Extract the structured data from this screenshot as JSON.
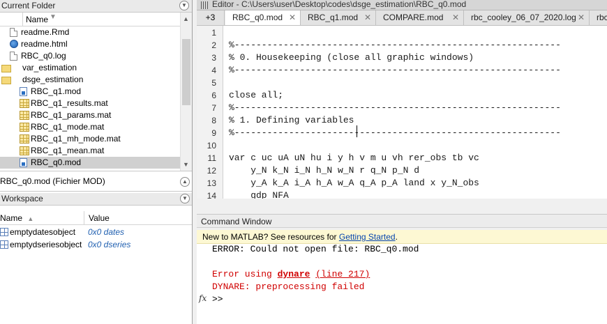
{
  "current_folder": {
    "title": "Current Folder",
    "name_header": "Name",
    "sort_indicator": "▼",
    "files": [
      {
        "name": "readme.Rmd",
        "icon": "document-icon",
        "indent": 0
      },
      {
        "name": "readme.html",
        "icon": "html-file-icon",
        "indent": 0
      },
      {
        "name": "RBC_q0.log",
        "icon": "document-icon",
        "indent": 0
      },
      {
        "name": "var_estimation",
        "icon": "folder-icon",
        "indent": 0
      },
      {
        "name": "dsge_estimation",
        "icon": "folder-icon",
        "indent": 0
      },
      {
        "name": "RBC_q1.mod",
        "icon": "mod-file-icon",
        "indent": 1
      },
      {
        "name": "RBC_q1_results.mat",
        "icon": "mat-file-icon",
        "indent": 1
      },
      {
        "name": "RBC_q1_params.mat",
        "icon": "mat-file-icon",
        "indent": 1
      },
      {
        "name": "RBC_q1_mode.mat",
        "icon": "mat-file-icon",
        "indent": 1
      },
      {
        "name": "RBC_q1_mh_mode.mat",
        "icon": "mat-file-icon",
        "indent": 1
      },
      {
        "name": "RBC_q1_mean.mat",
        "icon": "mat-file-icon",
        "indent": 1
      },
      {
        "name": "RBC_q0.mod",
        "icon": "mod-file-icon",
        "indent": 1,
        "selected": true
      },
      {
        "name": "RBC_q0.mod",
        "icon": "mod-file-icon",
        "indent": 1
      }
    ],
    "details": "RBC_q0.mod  (Fichier MOD)"
  },
  "workspace": {
    "title": "Workspace",
    "col_name": "Name",
    "col_value": "Value",
    "sort_indicator": "▲",
    "vars": [
      {
        "name": "emptydatesobject",
        "value": "0x0 dates"
      },
      {
        "name": "emptydseriesobject",
        "value": "0x0 dseries"
      }
    ]
  },
  "editor": {
    "title": "Editor - C:\\Users\\user\\Desktop\\codes\\dsge_estimation\\RBC_q0.mod",
    "tab_overflow": "+3",
    "tabs": [
      {
        "label": "RBC_q0.mod",
        "active": true
      },
      {
        "label": "RBC_q1.mod",
        "active": false
      },
      {
        "label": "COMPARE.mod",
        "active": false
      },
      {
        "label": "rbc_cooley_06_07_2020.log",
        "active": false
      },
      {
        "label": "rbc",
        "active": false
      }
    ],
    "line_numbers": [
      "1",
      "2",
      "3",
      "4",
      "5",
      "6",
      "7",
      "8",
      "9",
      "10",
      "11",
      "12",
      "13",
      "14"
    ],
    "lines": [
      "",
      "%------------------------------------------------------------",
      "% 0. Housekeeping (close all graphic windows)",
      "%------------------------------------------------------------",
      "",
      "close all;",
      "%------------------------------------------------------------",
      "% 1. Defining variables",
      "%------------------------------------------------------------",
      "",
      "var c uc uA uN hu i y h v m u vh rer_obs tb vc",
      "    y_N k_N i_N h_N w_N r q_N p_N d",
      "    y_A k_A i_A h_A w_A q_A p_A land x y_N_obs",
      "    gdp NFA"
    ]
  },
  "command_window": {
    "title": "Command Window",
    "banner_text": "New to MATLAB? See resources for ",
    "banner_link": "Getting Started",
    "banner_end": ".",
    "error_file": "ERROR: Could not open file: RBC_q0.mod",
    "error_using": "Error using ",
    "error_func": "dynare",
    "error_space": " ",
    "error_line": "(line 217)",
    "dynare_msg": "DYNARE: preprocessing failed",
    "fx": "fx",
    "prompt": ">>"
  }
}
